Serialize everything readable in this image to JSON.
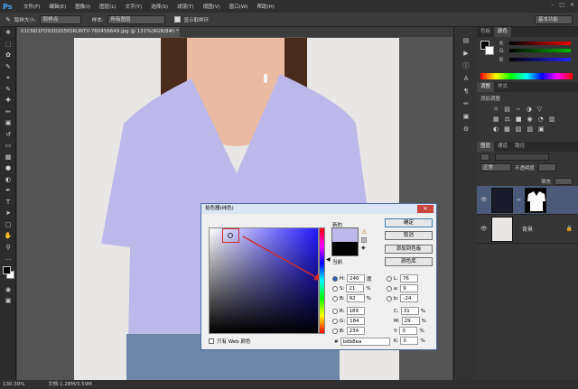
{
  "app": {
    "logo": "Ps"
  },
  "menu": [
    "文件(F)",
    "编辑(E)",
    "图像(I)",
    "图层(L)",
    "文字(Y)",
    "选择(S)",
    "滤镜(T)",
    "视图(V)",
    "窗口(W)",
    "帮助(H)"
  ],
  "options": {
    "size_label": "取样大小:",
    "size_value": "取样点",
    "sample_label": "样本:",
    "sample_value": "所有图层",
    "show_ring_label": "显示取样环",
    "workspace": "基本功能"
  },
  "document": {
    "tab_title": "01CN01FO93D205fOKUNTV-760456649.jpg @ 131%(RGB/8#) *"
  },
  "status": {
    "zoom": "130.39%",
    "doc_info": "文档:1.28M/3.59M"
  },
  "panels": {
    "color_tabs": [
      "色板",
      "颜色"
    ],
    "adjust_tabs": [
      "调整",
      "样式"
    ],
    "adjust_title": "添加调整",
    "layer_tabs": [
      "图层",
      "通道",
      "路径"
    ],
    "blend_mode": "正常",
    "opacity_label": "不透明度",
    "fill_label": "填充",
    "layers": [
      {
        "name": ""
      },
      {
        "name": "背景"
      }
    ]
  },
  "picker": {
    "title": "拾色器(纯色)",
    "new_label": "新的",
    "current_label": "当前",
    "ok": "确定",
    "cancel": "取消",
    "add_swatch": "添加到色板",
    "libraries": "颜色库",
    "only_web": "只有 Web 颜色",
    "hsb": {
      "h": "246",
      "s": "21",
      "b": "92"
    },
    "rgb": {
      "r": "189",
      "g": "184",
      "b": "234"
    },
    "lab": {
      "l": "76",
      "a": "9",
      "b": "-24"
    },
    "cmyk": {
      "c": "31",
      "m": "29",
      "y": "0",
      "k": "0"
    },
    "hex": "bdb8ea",
    "units": {
      "deg": "度",
      "pct": "%"
    },
    "new_color": "#bdb8ea",
    "current_color": "#000000"
  },
  "colors": {
    "shirt": "#bdb8ea",
    "accent": "#d42a2a"
  }
}
